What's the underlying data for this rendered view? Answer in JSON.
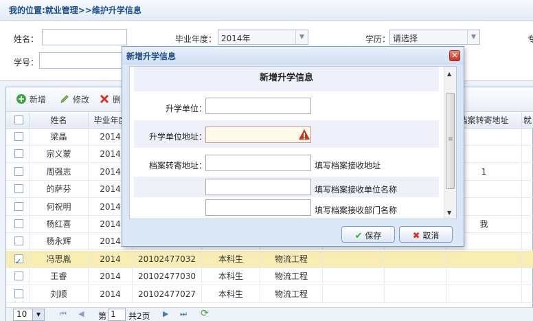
{
  "breadcrumb": "我的位置:就业管理>>维护升学信息",
  "filter": {
    "name_label": "姓名：",
    "name_value": "",
    "year_label": "毕业年度：",
    "year_value": "2014年",
    "edu_label": "学历：",
    "edu_value": "请选择",
    "cut_label": "专",
    "student_no_label": "学号："
  },
  "toolbar": {
    "add_label": "新增",
    "edit_label": "修改",
    "delete_label": "删"
  },
  "grid": {
    "columns": [
      "姓名",
      "毕业年度",
      "",
      "",
      "",
      "档案转寄地址",
      "就"
    ],
    "rows": [
      {
        "checked": false,
        "name": "梁晶",
        "year": "2014",
        "no": "",
        "edu": "",
        "major": "",
        "addr": "",
        "extra": ""
      },
      {
        "checked": false,
        "name": "宗义蒙",
        "year": "2014",
        "no": "",
        "edu": "",
        "major": "",
        "addr": "",
        "extra": ""
      },
      {
        "checked": false,
        "name": "周强志",
        "year": "2014",
        "no": "",
        "edu": "",
        "major": "",
        "addr": "1",
        "extra": ""
      },
      {
        "checked": false,
        "name": "的萨芬",
        "year": "2014",
        "no": "",
        "edu": "",
        "major": "",
        "addr": "",
        "extra": ""
      },
      {
        "checked": false,
        "name": "何祝明",
        "year": "2014",
        "no": "",
        "edu": "",
        "major": "",
        "addr": "",
        "extra": ""
      },
      {
        "checked": false,
        "name": "杨红喜",
        "year": "2014",
        "no": "",
        "edu": "",
        "major": "",
        "addr": "我",
        "extra": ""
      },
      {
        "checked": false,
        "name": "杨永辉",
        "year": "2014",
        "no": "",
        "edu": "",
        "major": "",
        "addr": "",
        "extra": ""
      },
      {
        "checked": true,
        "name": "冯思胤",
        "year": "2014",
        "no": "20102477032",
        "edu": "本科生",
        "major": "物流工程",
        "addr": "",
        "extra": ""
      },
      {
        "checked": false,
        "name": "王睿",
        "year": "2014",
        "no": "20102477030",
        "edu": "本科生",
        "major": "物流工程",
        "addr": "",
        "extra": ""
      },
      {
        "checked": false,
        "name": "刘顺",
        "year": "2014",
        "no": "20102477027",
        "edu": "本科生",
        "major": "物流工程",
        "addr": "",
        "extra": ""
      }
    ]
  },
  "pager": {
    "page_size": "10",
    "page_label": "第",
    "page_value": "1",
    "total_label": "共2页"
  },
  "dialog": {
    "title": "新增升学信息",
    "heading": "新增升学信息",
    "school_label": "升学单位：",
    "school_addr_label": "升学单位地址：",
    "archive_addr_label": "档案转寄地址：",
    "archive_addr_hint": "填写档案接收地址",
    "archive_unit_hint": "填写档案接收单位名称",
    "archive_dept_hint": "填写档案接收部门名称",
    "save_label": "保存",
    "cancel_label": "取消"
  },
  "colors": {
    "accent": "#1d4e89",
    "selected_row": "#f8eeb4",
    "error_icon": "#c8321e"
  }
}
